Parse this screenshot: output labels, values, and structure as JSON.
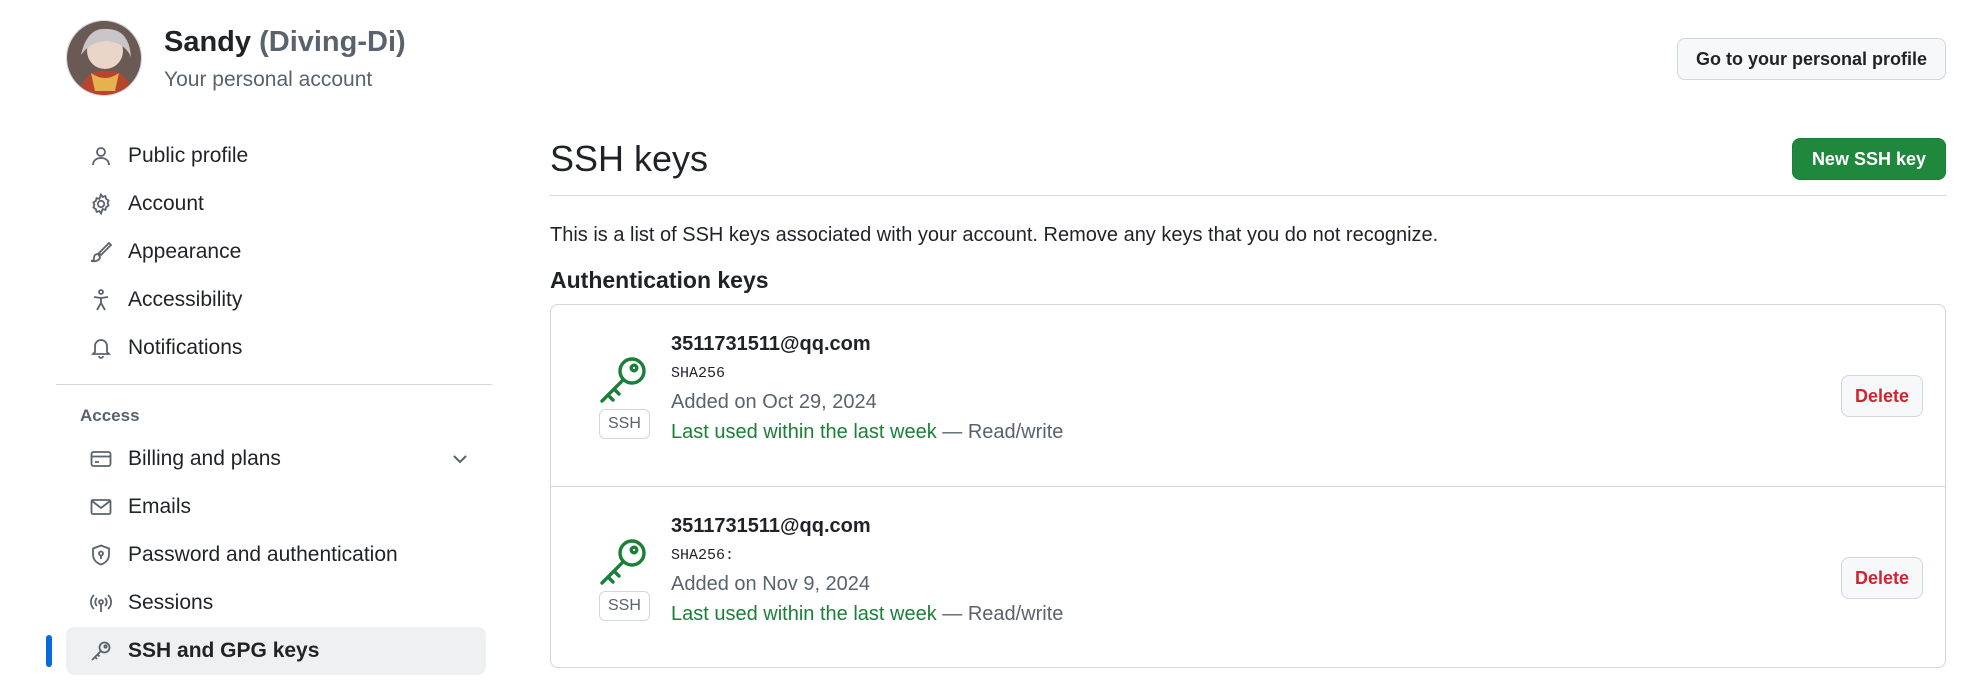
{
  "account": {
    "name": "Sandy",
    "login": "(Diving-Di)",
    "subtitle": "Your personal account",
    "profile_button": "Go to your personal profile"
  },
  "sidebar": {
    "items": [
      {
        "label": "Public profile",
        "icon": "person-icon"
      },
      {
        "label": "Account",
        "icon": "gear-icon"
      },
      {
        "label": "Appearance",
        "icon": "paintbrush-icon"
      },
      {
        "label": "Accessibility",
        "icon": "accessibility-icon"
      },
      {
        "label": "Notifications",
        "icon": "bell-icon"
      }
    ],
    "access_label": "Access",
    "access_items": [
      {
        "label": "Billing and plans",
        "icon": "credit-card-icon"
      },
      {
        "label": "Emails",
        "icon": "mail-icon"
      },
      {
        "label": "Password and authentication",
        "icon": "shield-lock-icon"
      },
      {
        "label": "Sessions",
        "icon": "broadcast-icon"
      },
      {
        "label": "SSH and GPG keys",
        "icon": "key-icon",
        "active": true
      }
    ]
  },
  "main": {
    "title": "SSH keys",
    "new_button": "New SSH key",
    "description": "This is a list of SSH keys associated with your account. Remove any keys that you do not recognize.",
    "section_title": "Authentication keys",
    "keys": [
      {
        "title": "3511731511@qq.com",
        "badge": "SSH",
        "fingerprint": "SHA256",
        "added": "Added on Oct 29, 2024",
        "last_used": "Last used within the last week",
        "access": " — Read/write",
        "delete": "Delete"
      },
      {
        "title": "3511731511@qq.com",
        "badge": "SSH",
        "fingerprint": "SHA256:",
        "added": "Added on Nov 9, 2024",
        "last_used": "Last used within the last week",
        "access": " — Read/write",
        "delete": "Delete"
      }
    ]
  },
  "colors": {
    "accent_green": "#1f883d",
    "key_green": "#1a7f37",
    "danger": "#d1242f",
    "active_bar": "#0969da"
  }
}
